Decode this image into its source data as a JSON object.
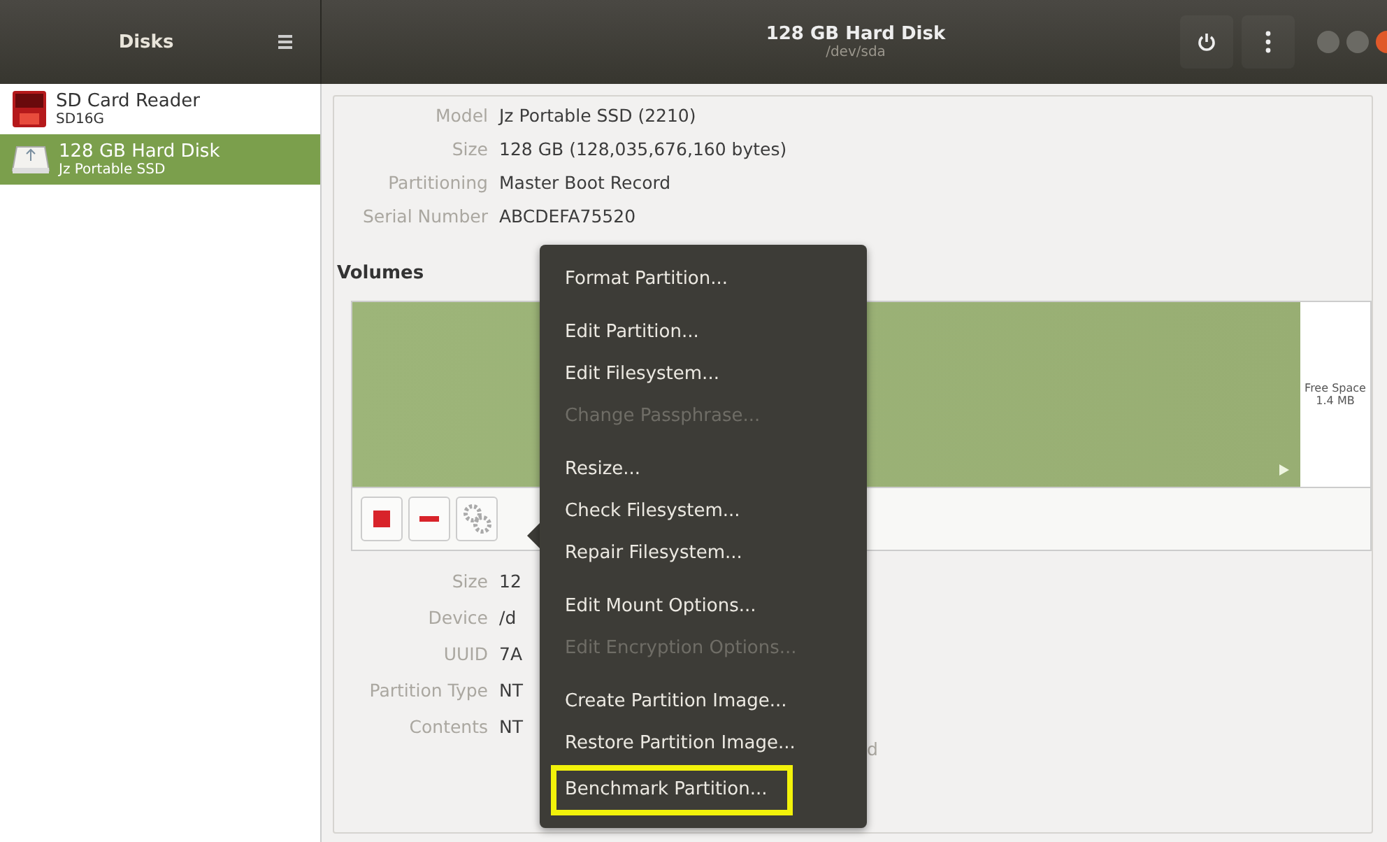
{
  "header": {
    "sidebar_title": "Disks",
    "title": "128 GB Hard Disk",
    "subtitle": "/dev/sda"
  },
  "sidebar": {
    "items": [
      {
        "name": "SD Card Reader",
        "detail": "SD16G",
        "kind": "sdcard",
        "selected": false
      },
      {
        "name": "128 GB Hard Disk",
        "detail": "Jz Portable SSD",
        "kind": "harddisk",
        "selected": true
      }
    ]
  },
  "drive_info": [
    {
      "label": "Model",
      "value": "Jz Portable SSD (2210)"
    },
    {
      "label": "Size",
      "value": "128 GB (128,035,676,160 bytes)"
    },
    {
      "label": "Partitioning",
      "value": "Master Boot Record"
    },
    {
      "label": "Serial Number",
      "value": "ABCDEFA75520"
    }
  ],
  "volumes": {
    "heading": "Volumes",
    "free_space": {
      "label": "Free Space",
      "size": "1.4 MB"
    }
  },
  "partition_info": [
    {
      "label": "Size",
      "value": "12"
    },
    {
      "label": "Device",
      "value": "/d"
    },
    {
      "label": "UUID",
      "value": "7A"
    },
    {
      "label": "Partition Type",
      "value": "NT"
    },
    {
      "label": "Contents",
      "value": "NT",
      "tail": "d"
    }
  ],
  "menu": {
    "groups": [
      [
        {
          "label": "Format Partition...",
          "disabled": false,
          "highlighted": false
        }
      ],
      [
        {
          "label": "Edit Partition...",
          "disabled": false,
          "highlighted": false
        },
        {
          "label": "Edit Filesystem...",
          "disabled": false,
          "highlighted": false
        },
        {
          "label": "Change Passphrase...",
          "disabled": true,
          "highlighted": false
        }
      ],
      [
        {
          "label": "Resize...",
          "disabled": false,
          "highlighted": false
        },
        {
          "label": "Check Filesystem...",
          "disabled": false,
          "highlighted": false
        },
        {
          "label": "Repair Filesystem...",
          "disabled": false,
          "highlighted": false
        }
      ],
      [
        {
          "label": "Edit Mount Options...",
          "disabled": false,
          "highlighted": false
        },
        {
          "label": "Edit Encryption Options...",
          "disabled": true,
          "highlighted": false
        }
      ],
      [
        {
          "label": "Create Partition Image...",
          "disabled": false,
          "highlighted": false
        },
        {
          "label": "Restore Partition Image...",
          "disabled": false,
          "highlighted": false
        },
        {
          "label": "Benchmark Partition...",
          "disabled": false,
          "highlighted": true
        }
      ]
    ]
  }
}
